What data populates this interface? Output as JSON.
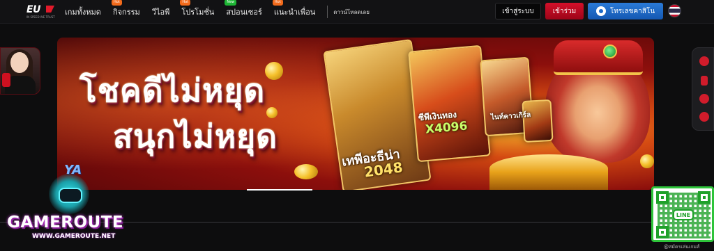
{
  "header": {
    "logo_text": "EU",
    "logo_tagline": "IN SPEED WE TRUST",
    "nav_items": [
      {
        "label": "เกมทั้งหมด",
        "badge": ""
      },
      {
        "label": "กิจกรรม",
        "badge": "Hot"
      },
      {
        "label": "วีไอพี",
        "badge": ""
      },
      {
        "label": "โปรโมชั่น",
        "badge": "Hot"
      },
      {
        "label": "สปอนเซอร์",
        "badge": "New"
      },
      {
        "label": "แนะนำเพื่อน",
        "badge": "Hot"
      }
    ],
    "download_label": "ดาวน์โหลดเลย",
    "login_label": "เข้าสู่ระบบ",
    "join_label": "เข้าร่วม",
    "promo_label": "โทรเลขคาสิโน",
    "language_flag": "thailand-flag-icon"
  },
  "banner": {
    "headline_line1": "โชคดีไม่หยุด",
    "headline_line2": "สนุกไม่หยุด",
    "game1_title": "เทพีอะธีน่า",
    "game1_number": "2048",
    "game2_title": "ซีพีเงินทอง",
    "game2_number": "X4096",
    "game3_title": "ไนท์คาวเกิร์ล",
    "provider_logo": "YA"
  },
  "watermark": {
    "brand": "GAMEROUTE",
    "url": "WWW.GAMEROUTE.NET"
  },
  "qr": {
    "badge": "LINE",
    "caption": "@สมัครเล่นเกมส์"
  },
  "colors": {
    "accent_red": "#d4102a",
    "accent_blue": "#1c6ac8",
    "line_green": "#1fa12a"
  }
}
